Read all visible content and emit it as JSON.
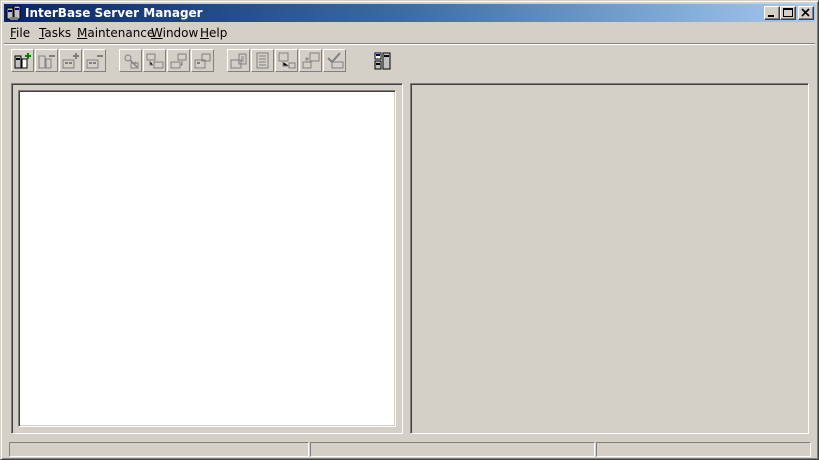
{
  "window": {
    "title": "InterBase Server Manager",
    "accent": "#0a246a",
    "face_color": "#d4d0c8"
  },
  "title_buttons": [
    {
      "name": "minimize-button",
      "icon": "minimize-icon"
    },
    {
      "name": "maximize-button",
      "icon": "maximize-icon"
    },
    {
      "name": "close-button",
      "icon": "close-icon"
    }
  ],
  "menu": {
    "items": [
      {
        "label": "File",
        "accel": "F",
        "rest": "ile"
      },
      {
        "label": "Tasks",
        "accel": "T",
        "rest": "asks"
      },
      {
        "label": "Maintenance",
        "accel": "M",
        "rest": "aintenance"
      },
      {
        "label": "Window",
        "accel": "W",
        "rest": "indow"
      },
      {
        "label": "Help",
        "accel": "H",
        "rest": "elp"
      }
    ]
  },
  "toolbar": {
    "buttons": [
      {
        "icon": "server-login-icon",
        "enabled": true
      },
      {
        "icon": "server-logout-icon",
        "enabled": false
      },
      {
        "icon": "database-connect-icon",
        "enabled": false
      },
      {
        "icon": "database-disconnect-icon",
        "enabled": false
      },
      {
        "icon": "security-icon",
        "enabled": false
      },
      {
        "icon": "backup-icon",
        "enabled": false
      },
      {
        "icon": "restore-icon",
        "enabled": false
      },
      {
        "icon": "sweep-icon",
        "enabled": false
      },
      {
        "icon": "database-statistics-icon",
        "enabled": false
      },
      {
        "icon": "database-properties-icon",
        "enabled": false
      },
      {
        "icon": "transaction-recovery-icon",
        "enabled": false
      },
      {
        "icon": "database-shutdown-icon",
        "enabled": false
      },
      {
        "icon": "validation-icon",
        "enabled": false
      },
      {
        "icon": "windows-sql-icon",
        "enabled": true
      }
    ]
  },
  "status_bar": {
    "panels": [
      "",
      "",
      ""
    ]
  }
}
